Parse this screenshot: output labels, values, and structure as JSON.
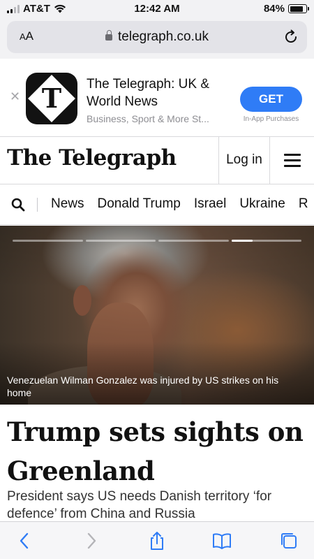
{
  "status_bar": {
    "carrier": "AT&T",
    "time": "12:42 AM",
    "battery_percent": "84%",
    "battery_level": 0.84
  },
  "browser": {
    "text_size_label": "AA",
    "url": "telegraph.co.uk"
  },
  "app_banner": {
    "title": "The Telegraph: UK & World News",
    "subtitle": "Business, Sport & More St...",
    "get_label": "GET",
    "in_app_label": "In-App Purchases"
  },
  "header": {
    "logo_text": "The Telegraph",
    "login_label": "Log in"
  },
  "section_nav": {
    "items": [
      "News",
      "Donald Trump",
      "Israel",
      "Ukraine",
      "R"
    ]
  },
  "hero": {
    "caption": "Venezuelan Wilman Gonzalez was injured by US strikes on his home",
    "slide_count": 4,
    "active_slide": 4
  },
  "article": {
    "headline": "Trump sets sights on Greenland",
    "standfirst": "President says US needs Danish territory ‘for defence’ from China and Russia"
  },
  "colors": {
    "accent_blue": "#2f7cf6",
    "safari_chrome": "#f2f2f4",
    "link_blue": "#2f7cf6"
  },
  "icons": {
    "back": "chevron-left-icon",
    "forward": "chevron-right-icon",
    "share": "share-icon",
    "bookmarks": "book-icon",
    "tabs": "tabs-icon"
  }
}
